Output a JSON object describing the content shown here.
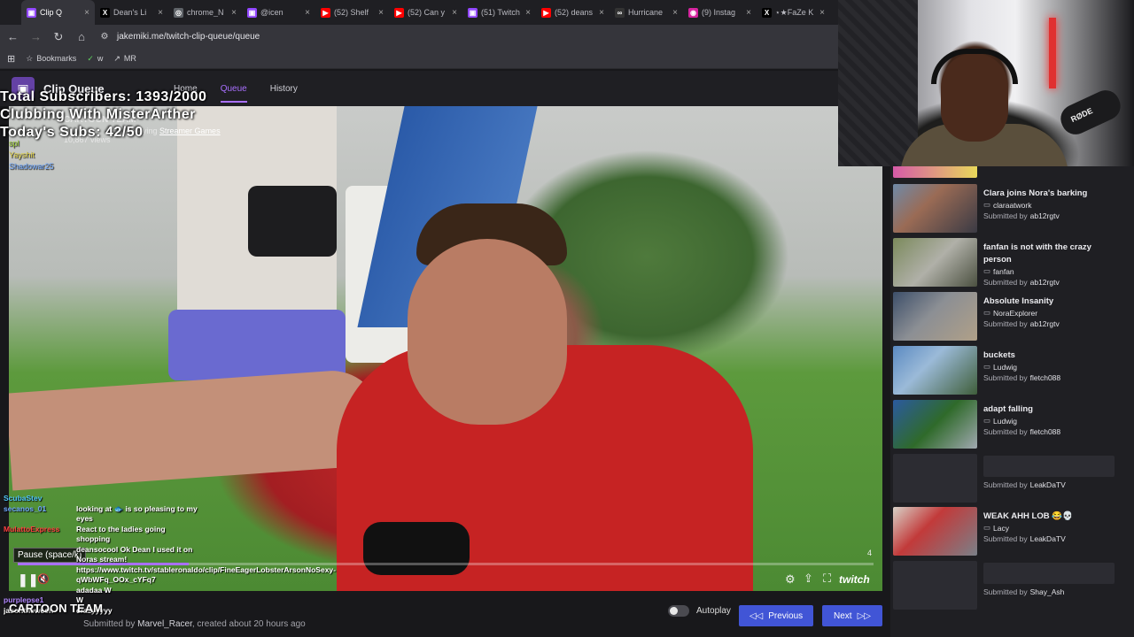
{
  "browser": {
    "tabs": [
      {
        "label": "Clip Q",
        "color": "#9146ff",
        "glyph": "▣",
        "active": true
      },
      {
        "label": "Dean's Li",
        "color": "#000000",
        "glyph": "X"
      },
      {
        "label": "chrome_N",
        "color": "#5f6368",
        "glyph": "◎"
      },
      {
        "label": "@icen",
        "color": "#9146ff",
        "glyph": "▣"
      },
      {
        "label": "(52) Shelf",
        "color": "#ff0000",
        "glyph": "▶"
      },
      {
        "label": "(52) Can y",
        "color": "#ff0000",
        "glyph": "▶"
      },
      {
        "label": "(51) Twitch",
        "color": "#9146ff",
        "glyph": "▣"
      },
      {
        "label": "(52) deans",
        "color": "#ff0000",
        "glyph": "▶"
      },
      {
        "label": "Hurricane",
        "color": "#333333",
        "glyph": "∞"
      },
      {
        "label": "(9) Instag",
        "color": "#d6249f",
        "glyph": "◉"
      },
      {
        "label": "⋆★FaZe K",
        "color": "#000000",
        "glyph": "X"
      }
    ],
    "url": "jakemiki.me/twitch-clip-queue/queue",
    "bookmarks": [
      {
        "label": "Bookmarks",
        "icon": "star-icon"
      },
      {
        "label": "w",
        "icon": "check-icon"
      },
      {
        "label": "MR",
        "icon": "arrow-icon"
      }
    ]
  },
  "app": {
    "title": "Clip Queue",
    "nav": [
      {
        "label": "Home",
        "active": false
      },
      {
        "label": "Queue",
        "active": true
      },
      {
        "label": "History",
        "active": false
      }
    ]
  },
  "overlay": {
    "lines": [
      "Total Subscribers: 1393/2000",
      "Clubbing With MisterArther",
      "Today's Subs: 42/50"
    ]
  },
  "current_clip": {
    "channel": "CARTOON TEAM",
    "game_prefix": "Playing",
    "game": "Streamer Games",
    "views": "10,867 views",
    "submitter": "Marvel_Racer",
    "created": "created about 20 hours ago",
    "submitted_prefix": "Submitted by",
    "counter": "4",
    "progress": 0.2
  },
  "player": {
    "pause_tooltip": "Pause (space/k)",
    "brand": "twitch"
  },
  "chat_top": [
    {
      "name": "spl",
      "color": "#9acd32"
    },
    {
      "name": "Yayshit",
      "color": "#e8d84a"
    },
    {
      "name": "Shadowar25",
      "color": "#6fa8ff"
    }
  ],
  "chat": [
    {
      "name": "ScubaStev",
      "color": "#4fc3f7",
      "msg": ""
    },
    {
      "name": "secanos_01",
      "color": "#6fa8ff",
      "msg": "looking at 🐟 is so pleasing to my eyes"
    },
    {
      "name": "MulattoExpress",
      "color": "#ff4040",
      "msg": "React to the ladies going shopping"
    },
    {
      "name": "",
      "color": "#ffffff",
      "msg": "deansocool Ok Dean I used it on Noras stream!"
    },
    {
      "name": "",
      "color": "#ffffff",
      "msg": "https://www.twitch.tv/stableronaldo/clip/FineEagerLobsterArsonNoSexy-qWbWFq_OOx_cYFq7"
    },
    {
      "name": "",
      "color": "#ffffff",
      "msg": "adadaa W"
    },
    {
      "name": "purplepse1",
      "color": "#b388ff",
      "msg": "W"
    },
    {
      "name": "jasontheween",
      "color": "#ffffff",
      "msg": "crazyyyyy"
    }
  ],
  "chat_footer": "CARTOON TEAM",
  "controls": {
    "autoplay_label": "Autoplay",
    "autoplay_on": false,
    "previous_label": "Previous",
    "next_label": "Next"
  },
  "queue": [
    {
      "title": "",
      "channel": "",
      "submitter": "",
      "thumb": "thumb-top",
      "partial": true
    },
    {
      "title": "Clara joins Nora's barking",
      "channel": "claraatwork",
      "submitter": "ab12rgtv",
      "thumb": "thumb-a"
    },
    {
      "title": "fanfan is not with the crazy person",
      "channel": "fanfan",
      "submitter": "ab12rgtv",
      "thumb": "thumb-b"
    },
    {
      "title": "Absolute Insanity",
      "channel": "NoraExplorer",
      "submitter": "ab12rgtv",
      "thumb": "thumb-c"
    },
    {
      "title": "buckets",
      "channel": "Ludwig",
      "submitter": "fletch088",
      "thumb": "thumb-d"
    },
    {
      "title": "adapt falling",
      "channel": "Ludwig",
      "submitter": "fletch088",
      "thumb": "thumb-e"
    },
    {
      "title": "",
      "channel": "",
      "submitter": "LeakDaTV",
      "thumb": "",
      "placeholder": true
    },
    {
      "title": "WEAK AHH LOB 😂💀",
      "channel": "Lacy",
      "submitter": "LeakDaTV",
      "thumb": "thumb-f"
    },
    {
      "title": "",
      "channel": "",
      "submitter": "Shay_Ash",
      "thumb": "",
      "placeholder": true
    }
  ],
  "queue_submitted_prefix": "Submitted by",
  "webcam": {
    "mic_brand": "RØDE"
  }
}
